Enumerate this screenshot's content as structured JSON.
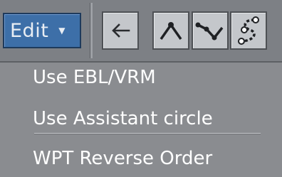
{
  "toolbar": {
    "edit_label": "Edit",
    "edit_caret": "▼",
    "buttons": [
      {
        "name": "back-button",
        "icon": "arrow-left-icon"
      },
      {
        "name": "route-single-leg-button",
        "icon": "route-leg-icon"
      },
      {
        "name": "route-multi-leg-button",
        "icon": "route-waypoints-icon"
      },
      {
        "name": "route-reverse-button",
        "icon": "route-curve-icon"
      }
    ]
  },
  "menu": {
    "items": [
      {
        "label": "Use EBL/VRM"
      },
      {
        "label": "Use Assistant circle"
      },
      {
        "label": "WPT Reverse Order"
      }
    ]
  },
  "colors": {
    "edit_button_bg": "#3d6fa8",
    "menu_bg": "#8a8c90",
    "menu_text": "#ffffff"
  }
}
